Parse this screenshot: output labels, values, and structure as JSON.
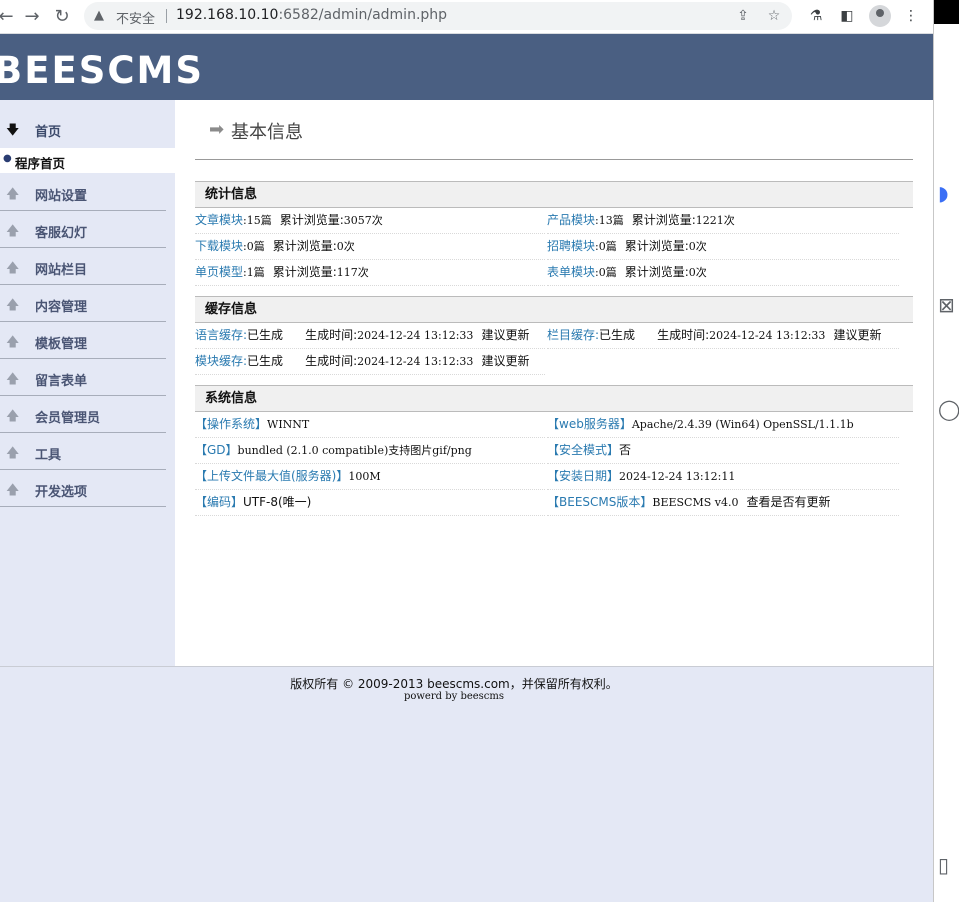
{
  "browser": {
    "security_label": "不安全",
    "url_host": "192.168.10.10",
    "url_rest": ":6582/admin/admin.php"
  },
  "header": {
    "logo": "BEESCMS"
  },
  "sidebar": {
    "home_label": "首页",
    "home_sub_label": "程序首页",
    "items": [
      {
        "label": "网站设置"
      },
      {
        "label": "客服幻灯"
      },
      {
        "label": "网站栏目"
      },
      {
        "label": "内容管理"
      },
      {
        "label": "模板管理"
      },
      {
        "label": "留言表单"
      },
      {
        "label": "会员管理员"
      },
      {
        "label": "工具"
      },
      {
        "label": "开发选项"
      }
    ]
  },
  "main": {
    "title": "基本信息",
    "stats": {
      "heading": "统计信息",
      "view_label": "累计浏览量:",
      "rows": [
        [
          {
            "k": "文章模块",
            "count": ":15篇",
            "views": "3057次"
          },
          {
            "k": "产品模块",
            "count": ":13篇",
            "views": "1221次"
          }
        ],
        [
          {
            "k": "下载模块",
            "count": ":0篇",
            "views": "0次"
          },
          {
            "k": "招聘模块",
            "count": ":0篇",
            "views": "0次"
          }
        ],
        [
          {
            "k": "单页模型",
            "count": ":1篇",
            "views": "117次"
          },
          {
            "k": "表单模块",
            "count": ":0篇",
            "views": "0次"
          }
        ]
      ]
    },
    "cache": {
      "heading": "缓存信息",
      "status": "已生成",
      "time_label": "生成时间:",
      "suggest": "建议更新",
      "items": [
        {
          "k": "语言缓存:",
          "time": "2024-12-24 13:12:33"
        },
        {
          "k": "栏目缓存:",
          "time": "2024-12-24 13:12:33"
        },
        {
          "k": "模块缓存:",
          "time": "2024-12-24 13:12:33"
        }
      ]
    },
    "system": {
      "heading": "系统信息",
      "rows": [
        [
          {
            "k": "【操作系统】",
            "v": "WINNT"
          },
          {
            "k": "【web服务器】",
            "v": "Apache/2.4.39 (Win64) OpenSSL/1.1.1b"
          }
        ],
        [
          {
            "k": "【GD】",
            "v": "bundled (2.1.0 compatible)支持图片gif/png"
          },
          {
            "k": "【安全模式】",
            "v": "否"
          }
        ],
        [
          {
            "k": "【上传文件最大值(服务器)】",
            "v": "100M"
          },
          {
            "k": "【安装日期】",
            "v": "2024-12-24 13:12:11"
          }
        ],
        [
          {
            "k": "【编码】",
            "v": "UTF-8(唯一)"
          },
          {
            "k": "【BEESCMS版本】",
            "v": "BEESCMS v4.0",
            "extra": "查看是否有更新"
          }
        ]
      ]
    }
  },
  "footer": {
    "line1": "版权所有 © 2009-2013 beescms.com，并保留所有权利。",
    "line2": "powerd by beescms"
  }
}
